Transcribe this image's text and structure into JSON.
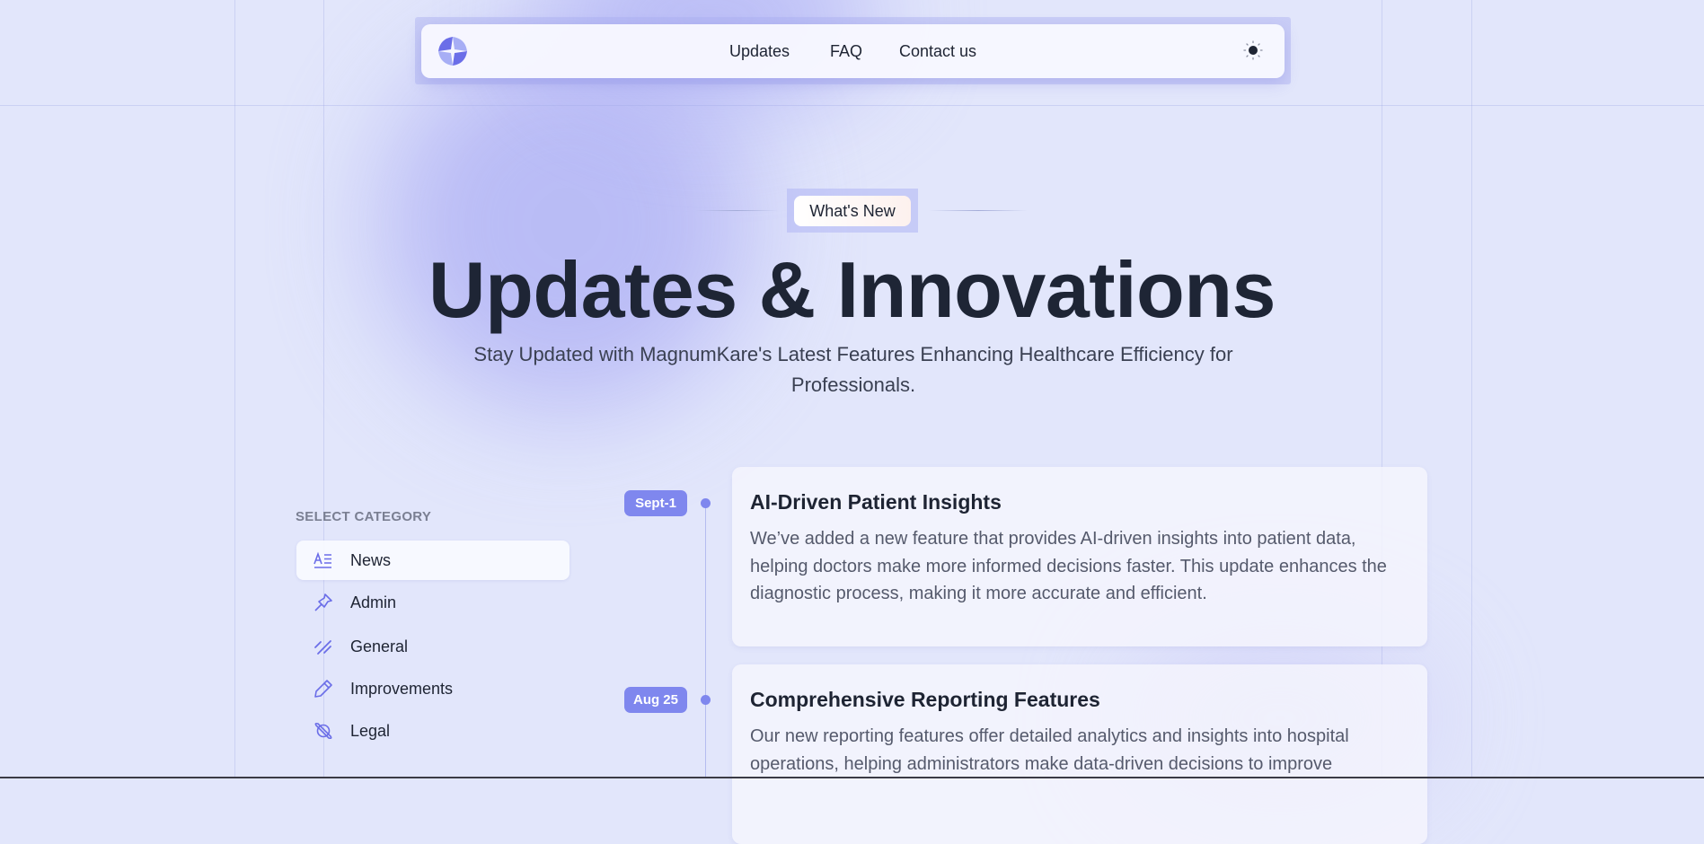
{
  "nav": {
    "links": [
      "Updates",
      "FAQ",
      "Contact us"
    ],
    "logo_icon": "magnumkare-logo",
    "theme_icon": "sun-icon"
  },
  "hero": {
    "eyebrow": "What's New",
    "title": "Updates & Innovations",
    "subtitle": "Stay Updated with MagnumKare's Latest Features Enhancing Healthcare Efficiency for Professionals."
  },
  "categories": {
    "label": "SELECT CATEGORY",
    "items": [
      {
        "label": "News",
        "icon": "text-icon",
        "active": true
      },
      {
        "label": "Admin",
        "icon": "pin-icon"
      },
      {
        "label": "General",
        "icon": "slashes-icon"
      },
      {
        "label": "Improvements",
        "icon": "pencil-icon"
      },
      {
        "label": "Legal",
        "icon": "planet-icon"
      }
    ]
  },
  "updates": [
    {
      "date": "Sept-1",
      "title": "AI-Driven Patient Insights",
      "body": "We’ve added a new feature that provides AI-driven insights into patient data, helping doctors make more informed decisions faster. This update enhances the diagnostic process, making it more accurate and efficient."
    },
    {
      "date": "Aug 25",
      "title": "Comprehensive Reporting Features",
      "body": "Our new reporting features offer detailed analytics and insights into hospital operations, helping administrators make data-driven decisions to improve"
    }
  ],
  "colors": {
    "accent": "#7f87ee",
    "background": "#e2e6fb",
    "text": "#1e2433"
  }
}
